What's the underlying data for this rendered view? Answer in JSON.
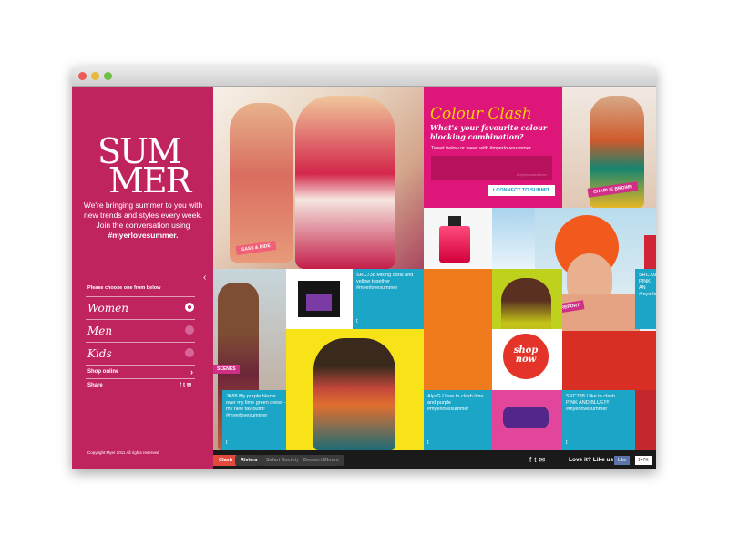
{
  "window": {
    "title": ""
  },
  "sidebar": {
    "logo_line1": "SUM",
    "logo_line2": "MER",
    "intro_before": "We're bringing summer to you with new trends and styles every week. Join the conversation using ",
    "intro_hashtag": "#myerlovesummer.",
    "choose_label": "Please choose one from below",
    "items": [
      {
        "label": "Women",
        "selected": true
      },
      {
        "label": "Men",
        "selected": false
      },
      {
        "label": "Kids",
        "selected": false
      }
    ],
    "shop_online": "Shop online",
    "share": "Share",
    "copyright": "Copyright Myer 2011 All rights reserved"
  },
  "tiles": {
    "sass_bide": "SASS & BIDE",
    "colour_clash_title": "Colour Clash",
    "colour_clash_question": "What's your favourite colour blocking combination?",
    "tweet_prompt": "Tweet below or tweet with #myerlovesummer",
    "tweet_placeholder": "#myerlovesummer",
    "connect_button": "CONNECT TO SUBMIT",
    "charlie_brown": "CHARLIE BROWN",
    "trend_report": "TREND REPORT",
    "scenes": "SCENES",
    "tweet_src1": "SRC738 Mixing coral and yellow together #myerlovesummer",
    "tweet_src_right": "SRC738 PINK AN #myerlo",
    "tweet_jk": "JK88 My purple blazer over my lime green dress - my new fav outfit! #myerlovesummer",
    "tweet_alyx": "AlyxG I love to clash lime and purple #myerlovesummer",
    "tweet_src2": "SRC738 I like to clash PINK AND BLUE!!!! #myerlovesummer",
    "shop_now_line1": "shop",
    "shop_now_line2": "now"
  },
  "bottombar": {
    "tabs": [
      "Clash",
      "Riviera",
      "Safari Society",
      "Dessert Bloom"
    ],
    "love_it": "Love it? Like us",
    "like": "Like",
    "like_count": "147K"
  },
  "colors": {
    "sidebar_pink": "#c0245f",
    "magenta": "#de1679",
    "cyan": "#1ba5c6",
    "yellow": "#f8e319"
  }
}
